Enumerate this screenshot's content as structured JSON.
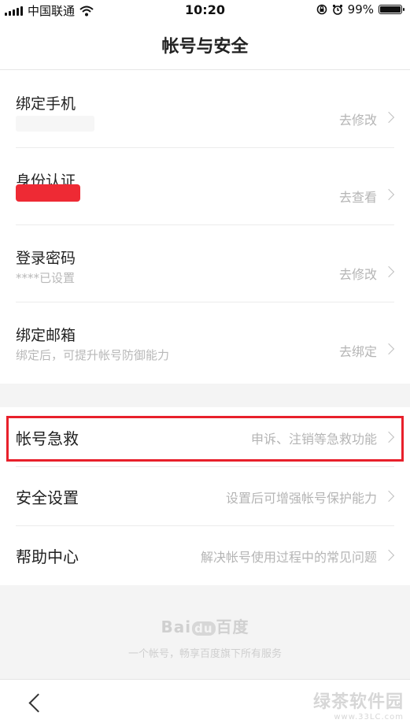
{
  "status_bar": {
    "carrier": "中国联通",
    "time": "10:20",
    "battery_text": "99%",
    "battery_level": 0.99,
    "icons": [
      "signal-icon",
      "wifi-icon",
      "rotation-lock-icon",
      "alarm-icon",
      "battery-icon"
    ]
  },
  "header": {
    "title": "帐号与安全"
  },
  "account_section": {
    "items": [
      {
        "label": "绑定手机",
        "subtitle": "",
        "action": "去修改"
      },
      {
        "label": "身份认证",
        "subtitle": "",
        "action": "去查看"
      },
      {
        "label": "登录密码",
        "subtitle": "****已设置",
        "action": "去修改"
      },
      {
        "label": "绑定邮箱",
        "subtitle": "绑定后，可提升帐号防御能力",
        "action": "去绑定"
      }
    ]
  },
  "security_section": {
    "items": [
      {
        "label": "帐号急救",
        "action": "申诉、注销等急救功能"
      },
      {
        "label": "安全设置",
        "action": "设置后可增强帐号保护能力"
      },
      {
        "label": "帮助中心",
        "action": "解决帐号使用过程中的常见问题"
      }
    ]
  },
  "footer": {
    "logo_bai": "Bai",
    "logo_du": "du",
    "logo_cn": "百度",
    "text": "一个帐号，畅享百度旗下所有服务"
  },
  "bottom_bar": {
    "back_icon": "back-arrow-icon"
  },
  "watermark": {
    "main": "绿茶软件园",
    "sub": "www.33LC.com"
  },
  "colors": {
    "highlight": "#e8202b",
    "redaction": "#ee2a34",
    "background": "#f4f4f4"
  }
}
